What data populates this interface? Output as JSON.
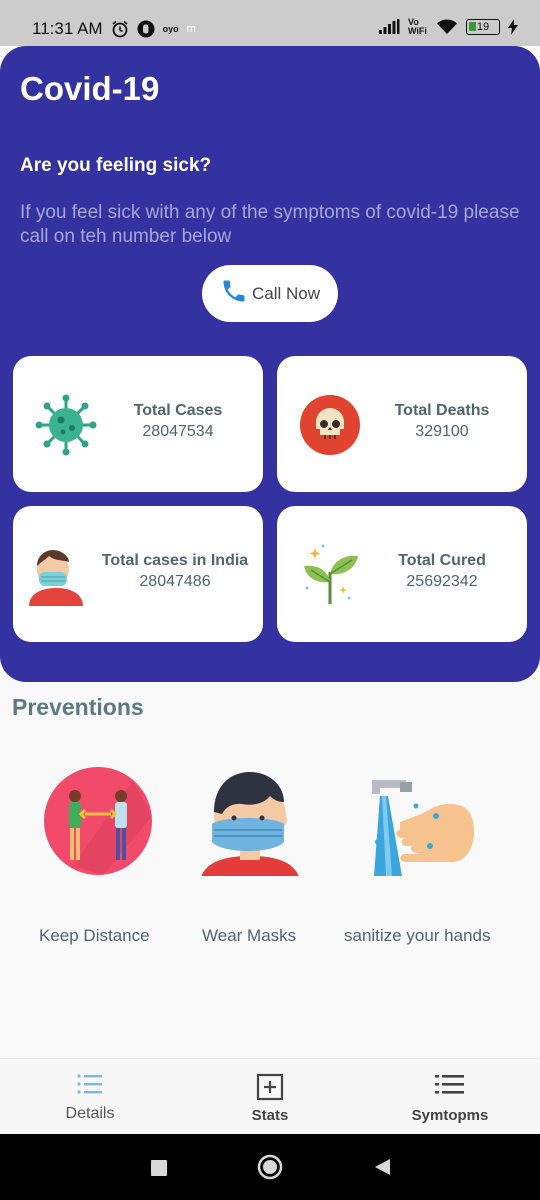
{
  "status_bar": {
    "time": "11:31 AM",
    "icons": [
      "alarm-icon",
      "opera-icon",
      "oyo-icon",
      "m-icon",
      "signal-icon",
      "vowifi-icon",
      "wifi-icon",
      "battery-icon",
      "charging-icon"
    ],
    "oyo_label": "oyo",
    "m_label": "m",
    "vowifi_label": "Vo WiFi",
    "battery_level": "19"
  },
  "header": {
    "title": "Covid-19",
    "question": "Are you feeling sick?",
    "description": "If you feel sick with any of the symptoms of covid-19 please call on teh number below",
    "call_button": {
      "label": "Call Now",
      "icon": "phone-icon"
    }
  },
  "stats": [
    {
      "label": "Total Cases",
      "value": "28047534",
      "icon": "virus-icon"
    },
    {
      "label": "Total Deaths",
      "value": "329100",
      "icon": "skull-icon"
    },
    {
      "label": "Total cases in India",
      "value": "28047486",
      "icon": "masked-person-icon"
    },
    {
      "label": "Total Cured",
      "value": "25692342",
      "icon": "sprout-icon"
    }
  ],
  "preventions": {
    "title": "Preventions",
    "items": [
      {
        "label": "Keep Distance",
        "icon": "keep-distance-icon"
      },
      {
        "label": "Wear Masks",
        "icon": "wear-mask-icon"
      },
      {
        "label": "sanitize your hands",
        "icon": "hand-wash-icon"
      }
    ]
  },
  "bottom_nav": {
    "items": [
      {
        "label": "Details",
        "icon": "details-list-icon"
      },
      {
        "label": "Stats",
        "icon": "plus-square-icon"
      },
      {
        "label": "Symtopms",
        "icon": "menu-list-icon"
      }
    ]
  },
  "colors": {
    "primary": "#3332a0",
    "accent_blue": "#4a90d9",
    "text_dark": "#4e6670",
    "background": "#f9f9f9"
  }
}
